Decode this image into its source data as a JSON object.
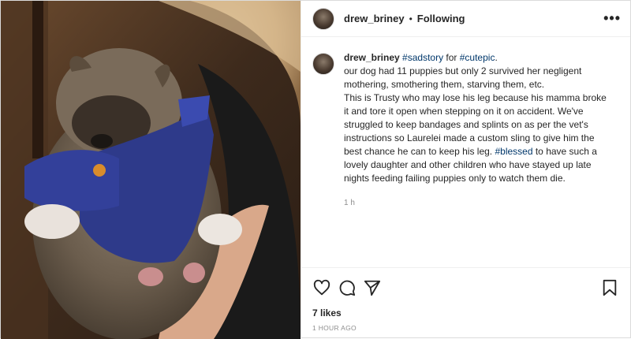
{
  "header": {
    "username": "drew_briney",
    "separator": "•",
    "follow_status": "Following",
    "more_icon": "more-options-icon"
  },
  "caption": {
    "username": "drew_briney",
    "tag1": "#sadstory",
    "for_word": " for ",
    "tag2": "#cutepic",
    "period": ".",
    "line2": "our dog had 11 puppies but only 2 survived her negligent mothering, smothering them, starving them, etc.",
    "line3": "This is Trusty who may lose his leg because his mamma broke it and tore it open when stepping on it on accident. We've struggled to keep bandages and splints on as per the vet's instructions so Laurelei made a custom sling to give him the best chance he can to keep his leg. ",
    "tag3": "#blessed",
    "line4": " to have such a lovely daughter and other children who have stayed up late nights feeding failing puppies only to watch them die.",
    "time": "1 h"
  },
  "actions": {
    "like_icon": "heart-icon",
    "comment_icon": "comment-icon",
    "share_icon": "share-icon",
    "save_icon": "bookmark-icon"
  },
  "likes": "7 likes",
  "posted_ago": "1 HOUR AGO",
  "colors": {
    "text": "#262626",
    "hashtag": "#00376b",
    "muted": "#8e8e8e",
    "border": "#dbdbdb"
  }
}
